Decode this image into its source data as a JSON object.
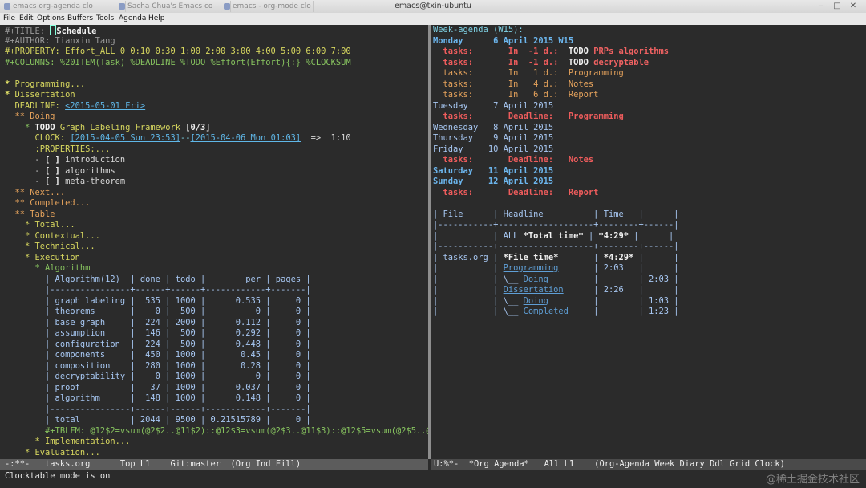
{
  "titlebar": {
    "tabs": [
      "emacs org-agenda clo",
      "Sacha Chua's Emacs co",
      "emacs - org-mode clo"
    ],
    "window_title": "emacs@txin-ubuntu"
  },
  "menubar": [
    "File",
    "Edit",
    "Options",
    "Buffers",
    "Tools",
    "Agenda",
    "Help"
  ],
  "left_buffer": [
    [
      [
        "gray",
        "#+TITLE: "
      ],
      [
        "cursor",
        ""
      ],
      [
        "white",
        "Schedule"
      ]
    ],
    [
      [
        "gray",
        "#+AUTHOR: Tianxin Tang"
      ]
    ],
    [
      [
        "y",
        "#+PROPERTY: Effort_ALL 0 0:10 0:30 1:00 2:00 3:00 4:00 5:00 6:00 7:00"
      ]
    ],
    [
      [
        "g",
        "#+COLUMNS: %20ITEM(Task) %DEADLINE %TODO %Effort(Effort){:} %CLOCKSUM"
      ]
    ],
    [
      [
        "def",
        ""
      ]
    ],
    [
      [
        "yb",
        "* "
      ],
      [
        "y",
        "Programming..."
      ]
    ],
    [
      [
        "yb",
        "* "
      ],
      [
        "y",
        "Dissertation"
      ]
    ],
    [
      [
        "y",
        "  DEADLINE: "
      ],
      [
        "lk",
        "<2015-05-01 Fri>"
      ]
    ],
    [
      [
        "or",
        "  ** Doing"
      ]
    ],
    [
      [
        "def",
        "    "
      ],
      [
        "g",
        "* "
      ],
      [
        "white",
        "TODO "
      ],
      [
        "y",
        "Graph Labeling Framework "
      ],
      [
        "white",
        "[0/3]"
      ]
    ],
    [
      [
        "y",
        "      CLOCK: "
      ],
      [
        "lk",
        "[2015-04-05 Sun 23:53]"
      ],
      [
        "cy",
        "--"
      ],
      [
        "lk",
        "[2015-04-06 Mon 01:03]"
      ],
      [
        "def",
        "  =>  1:10"
      ]
    ],
    [
      [
        "y",
        "      :PROPERTIES:..."
      ]
    ],
    [
      [
        "def",
        "      - "
      ],
      [
        "white",
        "[ ]"
      ],
      [
        "def",
        " introduction"
      ]
    ],
    [
      [
        "def",
        "      - "
      ],
      [
        "white",
        "[ ]"
      ],
      [
        "def",
        " algorithms"
      ]
    ],
    [
      [
        "def",
        "      - "
      ],
      [
        "white",
        "[ ]"
      ],
      [
        "def",
        " meta-theorem"
      ]
    ],
    [
      [
        "or",
        "  ** Next..."
      ]
    ],
    [
      [
        "or",
        "  ** Completed..."
      ]
    ],
    [
      [
        "or",
        "  ** Table"
      ]
    ],
    [
      [
        "y",
        "    * Total..."
      ]
    ],
    [
      [
        "y",
        "    * Contextual..."
      ]
    ],
    [
      [
        "y",
        "    * Technical..."
      ]
    ],
    [
      [
        "y",
        "    * Execution"
      ]
    ],
    [
      [
        "g",
        "      * Algorithm"
      ]
    ],
    [
      [
        "tb",
        "        | Algorithm(12)  | done | todo |        per | pages |"
      ]
    ],
    [
      [
        "tb",
        "        |----------------+------+------+------------+-------|"
      ]
    ],
    [
      [
        "tb",
        "        | graph labeling |  535 | 1000 |      0.535 |     0 |"
      ]
    ],
    [
      [
        "tb",
        "        | theorems       |    0 |  500 |          0 |     0 |"
      ]
    ],
    [
      [
        "tb",
        "        | base graph     |  224 | 2000 |      0.112 |     0 |"
      ]
    ],
    [
      [
        "tb",
        "        | assumption     |  146 |  500 |      0.292 |     0 |"
      ]
    ],
    [
      [
        "tb",
        "        | configuration  |  224 |  500 |      0.448 |     0 |"
      ]
    ],
    [
      [
        "tb",
        "        | components     |  450 | 1000 |       0.45 |     0 |"
      ]
    ],
    [
      [
        "tb",
        "        | composition    |  280 | 1000 |       0.28 |     0 |"
      ]
    ],
    [
      [
        "tb",
        "        | decryptability |    0 | 1000 |          0 |     0 |"
      ]
    ],
    [
      [
        "tb",
        "        | proof          |   37 | 1000 |      0.037 |     0 |"
      ]
    ],
    [
      [
        "tb",
        "        | algorithm      |  148 | 1000 |      0.148 |     0 |"
      ]
    ],
    [
      [
        "tb",
        "        |----------------+------+------+------------+-------|"
      ]
    ],
    [
      [
        "tb",
        "        | total          | 2044 | 9500 | 0.21515789 |     0 |"
      ]
    ],
    [
      [
        "g",
        "        #+TBLFM: @12$2=vsum(@2$2..@11$2)::@12$3=vsum(@2$3..@11$3)::@12$5=vsum(@2$5..@1▸"
      ]
    ],
    [
      [
        "y",
        "      * Implementation..."
      ]
    ],
    [
      [
        "y",
        "    * Evaluation..."
      ]
    ]
  ],
  "right_buffer": [
    [
      [
        "cy",
        "Week-agenda (W15):"
      ]
    ],
    [
      [
        "bl",
        "Monday      6 April 2015 W15"
      ]
    ],
    [
      [
        "red",
        "  tasks:       In  -1 d.:  "
      ],
      [
        "white",
        "TODO "
      ],
      [
        "redb",
        "PRPs algorithms"
      ]
    ],
    [
      [
        "red",
        "  tasks:       In  -1 d.:  "
      ],
      [
        "white",
        "TODO "
      ],
      [
        "redb",
        "decryptable"
      ]
    ],
    [
      [
        "or",
        "  tasks:       In   1 d.:  Programming"
      ]
    ],
    [
      [
        "or",
        "  tasks:       In   4 d.:  Notes"
      ]
    ],
    [
      [
        "or",
        "  tasks:       In   6 d.:  Report"
      ]
    ],
    [
      [
        "tb",
        "Tuesday     7 April 2015"
      ]
    ],
    [
      [
        "red",
        "  tasks:       Deadline:   Programming"
      ]
    ],
    [
      [
        "tb",
        "Wednesday   8 April 2015"
      ]
    ],
    [
      [
        "tb",
        "Thursday    9 April 2015"
      ]
    ],
    [
      [
        "tb",
        "Friday     10 April 2015"
      ]
    ],
    [
      [
        "red",
        "  tasks:       Deadline:   Notes"
      ]
    ],
    [
      [
        "bl",
        "Saturday   11 April 2015"
      ]
    ],
    [
      [
        "bl",
        "Sunday     12 April 2015"
      ]
    ],
    [
      [
        "red",
        "  tasks:       Deadline:   Report"
      ]
    ],
    [
      [
        "def",
        ""
      ]
    ],
    [
      [
        "tb",
        "| File      | Headline          | Time   |      |"
      ]
    ],
    [
      [
        "tb",
        "|-----------+-------------------+--------+------|"
      ]
    ],
    [
      [
        "tb",
        "|           | ALL "
      ],
      [
        "white",
        "*Total time*"
      ],
      [
        "tb",
        " | "
      ],
      [
        "white",
        "*4:29*"
      ],
      [
        "tb",
        " |      |"
      ]
    ],
    [
      [
        "tb",
        "|-----------+-------------------+--------+------|"
      ]
    ],
    [
      [
        "tb",
        "| tasks.org | "
      ],
      [
        "white",
        "*File time*"
      ],
      [
        "tb",
        "       | "
      ],
      [
        "white",
        "*4:29*"
      ],
      [
        "tb",
        " |      |"
      ]
    ],
    [
      [
        "tb",
        "|           | "
      ],
      [
        "tu",
        "Programming"
      ],
      [
        "tb",
        "       | 2:03   |      |"
      ]
    ],
    [
      [
        "tb",
        "|           | \\__ "
      ],
      [
        "tu",
        "Doing"
      ],
      [
        "tb",
        "         |        | 2:03 |"
      ]
    ],
    [
      [
        "tb",
        "|           | "
      ],
      [
        "tu",
        "Dissertation"
      ],
      [
        "tb",
        "      | 2:26   |      |"
      ]
    ],
    [
      [
        "tb",
        "|           | \\__ "
      ],
      [
        "tu",
        "Doing"
      ],
      [
        "tb",
        "         |        | 1:03 |"
      ]
    ],
    [
      [
        "tb",
        "|           | \\__ "
      ],
      [
        "tu",
        "Completed"
      ],
      [
        "tb",
        "     |        | 1:23 |"
      ]
    ]
  ],
  "modeline_left": "-:**-   tasks.org      Top L1    Git:master  (Org Ind Fill)",
  "modeline_right": "U:%*-  *Org Agenda*   All L1    (Org-Agenda Week Diary Ddl Grid Clock)",
  "echo_area": "Clocktable mode is on",
  "watermark": "@稀土掘金技术社区",
  "colors": {
    "bg": "#2b2b2b",
    "modeline": "#5c5c5c",
    "divider": "#8e8e8e"
  }
}
